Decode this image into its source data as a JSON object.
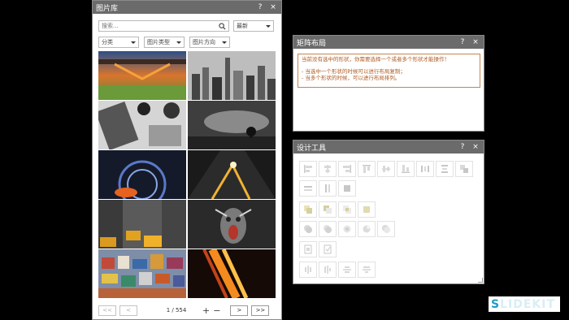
{
  "gallery": {
    "title": "图片库",
    "help": "?",
    "close": "×",
    "search_placeholder": "搜索...",
    "sort_selected": "最新",
    "filters": [
      "分类",
      "图片类型",
      "图片方向"
    ],
    "thumbnails": [
      "bridge-sunset-landscape",
      "city-skyline-bw",
      "laptop-desk-topdown",
      "stormy-landscape-tree",
      "tunnel-light-trail",
      "road-sunset-figure",
      "taxi-city-street",
      "screaming-face-art",
      "colorful-town-aerial",
      "orange-light-streaks"
    ],
    "pager": {
      "first": "<<",
      "prev": "<",
      "info": "1 / 554",
      "plus": "+",
      "minus": "−",
      "next": ">",
      "last": ">>"
    }
  },
  "matrix": {
    "title": "矩阵布局",
    "help": "?",
    "close": "×",
    "lines": [
      "当前没有选中的形状，你需要选择一个或者多个形状才能操作！",
      "",
      "- 当选中一个形状的时候可以进行布局复制；",
      "- 当多个形状的时候，可以进行布局排列。"
    ]
  },
  "design": {
    "title": "设计工具",
    "help": "?",
    "close": "×",
    "rows": [
      [
        "align-left-icon",
        "align-center-icon",
        "align-right-icon",
        "align-top-icon",
        "align-middle-icon",
        "align-bottom-icon",
        "distribute-h-icon",
        "distribute-v-icon",
        "group-icon"
      ],
      [
        "same-width-icon",
        "same-height-icon",
        "same-size-icon"
      ],
      [
        "merge-union-icon",
        "merge-subtract-icon",
        "merge-intersect-icon",
        "merge-combine-icon"
      ],
      [
        "shape-union-icon",
        "shape-fragment-icon",
        "shape-intersect-icon",
        "shape-combine-icon",
        "shape-subtract-icon"
      ],
      [
        "copy-format-icon",
        "paste-format-icon"
      ],
      [
        "rotate-left-icon",
        "rotate-right-icon",
        "flip-h-icon",
        "flip-v-icon"
      ]
    ]
  },
  "watermark": {
    "lead": "S",
    "rest": "LIDEKIT"
  }
}
